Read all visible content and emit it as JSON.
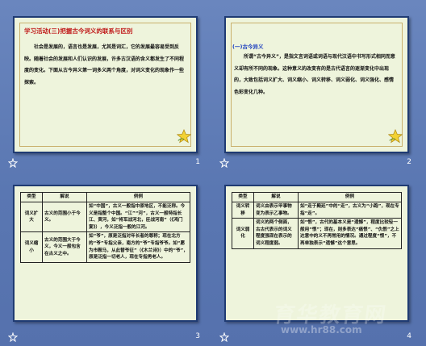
{
  "slides": [
    {
      "number": "1",
      "title": "学习活动(三)把握古今词义的联系与区别",
      "body": "社会是发展的，语言也是发展，尤其是词汇，它的发展最容易受到反映。随着社会的发展和人们认识的发展，许多古汉语的含义都发生了不同程度的变化。下面从古今异义第一词多义两个角度，对词义变化的现象作一些探索。"
    },
    {
      "number": "2",
      "heading": "(一)古今异义",
      "body": "所谓“古今异义”，是指文言词语或词语与现代汉语中书写形式相同而意义却有所不同的现象。这种意义的改变有的是古代语言的逐渐变化中出现的，大致包括词义扩大、词义缩小、词义转移、词义弱化、词义强化、感情色彩变化几种。"
    },
    {
      "number": "3",
      "headers": [
        "类型",
        "解说",
        "例例"
      ],
      "rows": [
        {
          "type": "词义扩大",
          "explain": "古义的范围小于今义。",
          "example": "如“中国”，古义一般指中原地区，不能泛称。今义是指整个中国。“江”“河”，古义一般特指长江、黄河，如“将军战河北，臣战河南”（《鸿门宴》），今义泛指一般的江河。"
        },
        {
          "type": "词义缩小",
          "explain": "古义的范围大于今义，今义一般包含在古义之中。",
          "example": "如“爷”，原是泛指对年长者的尊称；现在北方的“爷”专指父亲，南方的“爷”专指爷爷。如“愿为市鞍马，从此替爷征”（《木兰诗》）中的“爷”，原是泛指一切老人，现在专指男老人。"
        }
      ]
    },
    {
      "number": "4",
      "headers": [
        "类型",
        "解说",
        "例例"
      ],
      "rows": [
        {
          "type": "词义转移",
          "explain": "词义由表示甲事物变为表示乙事物。",
          "example": "如“走于殿廷”中的“走”，古义为“小跑”，现在专指“走”。"
        },
        {
          "type": "词义弱化",
          "explain": "词义的两个侧面，古古代表示的词义程度强现在表示的词义程度弱。",
          "example": "如“恨”，古代的基本义是“遗憾”，程度比较轻一般用“恨”；现在，则多表达“痛恨”、“仇恨”之上达意中的义不再常用的情况。通过程度“恨”，不再单独表示“遗憾”这个意思。"
        }
      ]
    }
  ],
  "watermark": {
    "text": "育华教育网",
    "url": "www.hr88.com"
  },
  "icons": {
    "star": "star-icon",
    "slide_transition": "slide-transition-icon"
  },
  "colors": {
    "background": "#5b79b4",
    "slide_bg": "#eef4dc",
    "title_red": "#c01a1a",
    "heading_blue": "#1b3dbf"
  }
}
